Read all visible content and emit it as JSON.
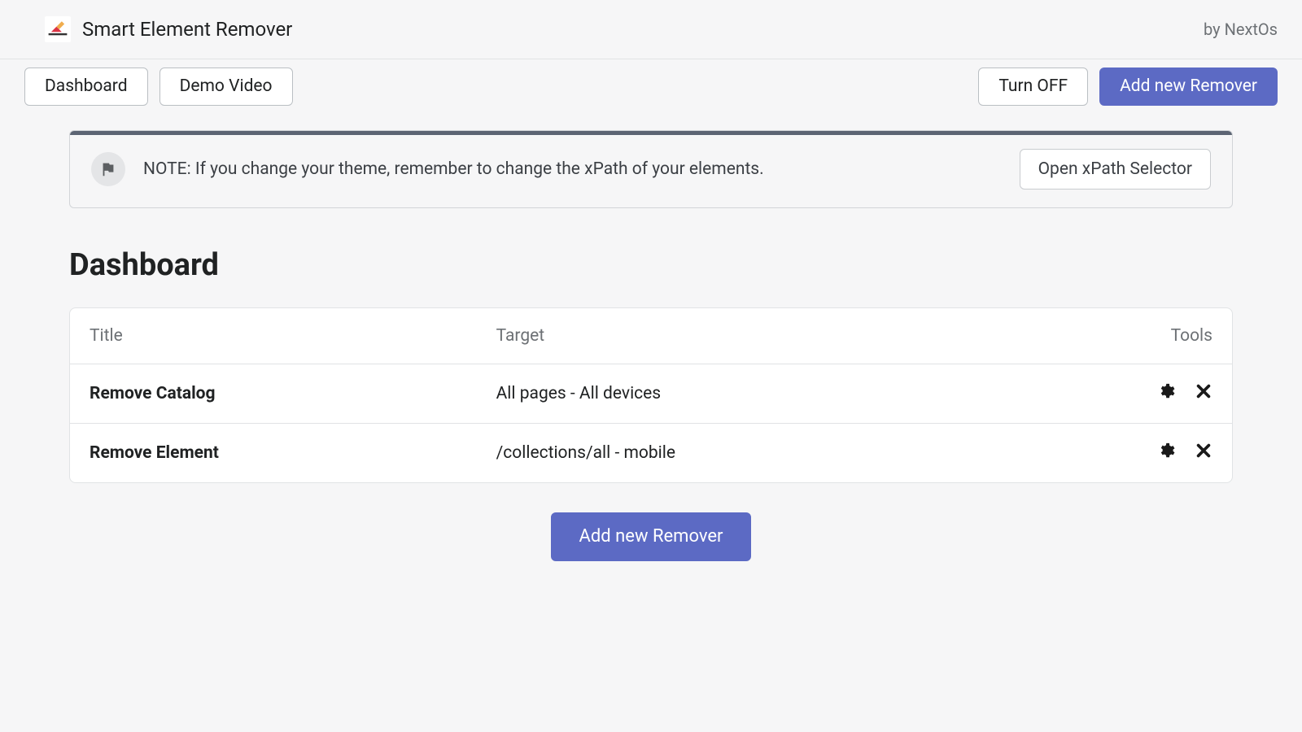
{
  "header": {
    "app_title": "Smart Element Remover",
    "byline": "by NextOs"
  },
  "toolbar": {
    "dashboard": "Dashboard",
    "demo_video": "Demo Video",
    "turn_off": "Turn OFF",
    "add_new": "Add new Remover"
  },
  "note": {
    "text": "NOTE: If you change your theme, remember to change the xPath of your elements.",
    "open_selector": "Open xPath Selector"
  },
  "page": {
    "title": "Dashboard"
  },
  "table": {
    "headers": {
      "title": "Title",
      "target": "Target",
      "tools": "Tools"
    },
    "rows": [
      {
        "title": "Remove Catalog",
        "target": "All pages - All devices"
      },
      {
        "title": "Remove Element",
        "target": "/collections/all - mobile"
      }
    ]
  },
  "actions": {
    "add_new_bottom": "Add new Remover"
  }
}
